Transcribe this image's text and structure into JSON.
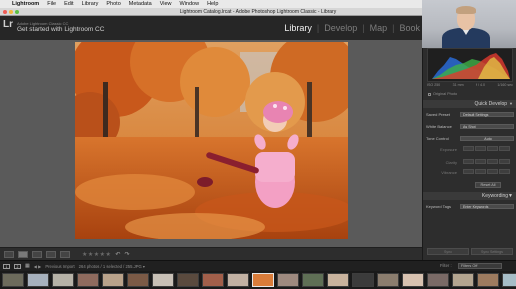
{
  "menubar": {
    "apple": "",
    "app_name": "Lightroom",
    "items": [
      "File",
      "Edit",
      "Library",
      "Photo",
      "Metadata",
      "View",
      "Window",
      "Help"
    ]
  },
  "window": {
    "title": "Lightroom Catalog.lrcat - Adobe Photoshop Lightroom Classic - Library"
  },
  "identity_plate": {
    "logo": "Lr",
    "line1": "Adobe Lightroom Classic CC",
    "line2": "Get started with Lightroom CC"
  },
  "modules": [
    {
      "label": "Library",
      "active": true
    },
    {
      "label": "Develop",
      "active": false
    },
    {
      "label": "Map",
      "active": false
    },
    {
      "label": "Book",
      "active": false
    }
  ],
  "module_separator": "|",
  "histogram": {
    "exif": [
      "ISO 250",
      "31 mm",
      "f / 4.0",
      "1/160 sec"
    ],
    "original_photo_label": "Original Photo"
  },
  "quick_develop": {
    "header": "Quick Develop",
    "saved_preset_label": "Saved Preset",
    "saved_preset_value": "Default Settings",
    "white_balance_label": "White Balance",
    "white_balance_value": "As Shot",
    "tone_control_label": "Tone Control",
    "tone_control_value": "Auto",
    "exposure_label": "Exposure",
    "clarity_label": "Clarity",
    "vibrance_label": "Vibrance",
    "reset_all": "Reset All"
  },
  "keywording": {
    "header": "Keywording",
    "keyword_tags_label": "Keyword Tags",
    "keyword_tags_value": "Enter Keywords"
  },
  "sync": {
    "sync_label": "Sync",
    "sync_settings_label": "Sync Settings"
  },
  "toolbar": {
    "stars": "★★★★★",
    "rotate_left": "↶",
    "rotate_right": "↷"
  },
  "filmstrip": {
    "monitor1": "1",
    "monitor2": "2",
    "grid_icon": "▦",
    "nav": "◀ ▶",
    "source": "Previous Import",
    "count": "264 photos / 1 selected / 255.JPG ▾",
    "filter_label": "Filter :",
    "filter_value": "Filters Off"
  },
  "colors": {
    "accent_active_module": "#f0f0f0",
    "panel_bg": "#2d2d2d",
    "center_bg": "#5a5a5a",
    "photo_orange": "#c9691e",
    "jacket_pink": "#f3a0c4"
  },
  "thumb_colors": [
    "#6d6b5c",
    "#a7b1bd",
    "#b6b2a7",
    "#8f6b5e",
    "#b9a28a",
    "#7b5a46",
    "#c8c0b6",
    "#5a4a3e",
    "#a25f4a",
    "#c2b1a3",
    "#d97c3a",
    "#9e8a7f",
    "#5f6f55",
    "#c9b39d",
    "#3b3b3b",
    "#8b7d6e",
    "#d8c2b0",
    "#7a6a66",
    "#b4a590",
    "#9d7b5f",
    "#a6bdc7",
    "#6f5d4f",
    "#c4b7a4"
  ],
  "selected_thumb": 10
}
